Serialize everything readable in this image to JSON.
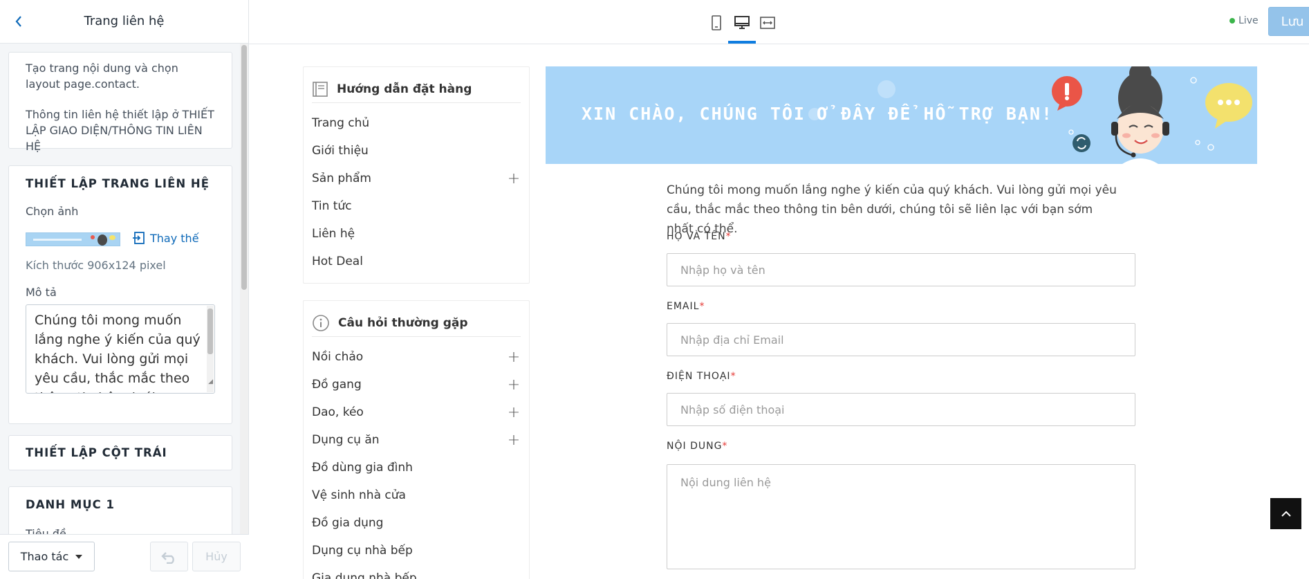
{
  "sidebar": {
    "title": "Trang liên hệ",
    "info_card": {
      "line1": "Tạo trang nội dung và chọn layout page.contact.",
      "line2": "Thông tin liên hệ thiết lập ở THIẾT LẬP GIAO DIỆN/THÔNG TIN LIÊN HỆ"
    },
    "contact_settings": {
      "title": "THIẾT LẬP TRANG LIÊN HỆ",
      "image_label": "Chọn ảnh",
      "replace_label": "Thay thế",
      "size_note": "Kích thước 906x124 pixel",
      "description_label": "Mô tả",
      "description_value": "Chúng tôi mong muốn lắng nghe ý kiến của quý khách. Vui lòng gửi mọi yêu cầu, thắc mắc theo thông tin bên dưới"
    },
    "left_column_title": "THIẾT LẬP CỘT TRÁI",
    "category1": {
      "title": "DANH MỤC 1",
      "subtitle": "Tiêu đề"
    },
    "footer": {
      "actions_label": "Thao tác",
      "cancel_label": "Hủy"
    }
  },
  "topbar": {
    "live_label": "Live",
    "save_label": "Lưu"
  },
  "preview": {
    "menu1": {
      "title": "Hướng dẫn đặt hàng",
      "items": [
        {
          "label": "Trang chủ",
          "expandable": false
        },
        {
          "label": "Giới thiệu",
          "expandable": false
        },
        {
          "label": "Sản phẩm",
          "expandable": true
        },
        {
          "label": "Tin tức",
          "expandable": false
        },
        {
          "label": "Liên hệ",
          "expandable": false
        },
        {
          "label": "Hot Deal",
          "expandable": false
        }
      ]
    },
    "menu2": {
      "title": "Câu hỏi thường gặp",
      "items": [
        {
          "label": "Nồi chảo",
          "expandable": true
        },
        {
          "label": "Đồ gang",
          "expandable": true
        },
        {
          "label": "Dao, kéo",
          "expandable": true
        },
        {
          "label": "Dụng cụ ăn",
          "expandable": true
        },
        {
          "label": "Đồ dùng gia đình",
          "expandable": false
        },
        {
          "label": "Vệ sinh nhà cửa",
          "expandable": false
        },
        {
          "label": "Đồ gia dụng",
          "expandable": false
        },
        {
          "label": "Dụng cụ nhà bếp",
          "expandable": false
        },
        {
          "label": "Gia dụng nhà bếp",
          "expandable": false
        }
      ]
    },
    "banner_text": "XIN CHÀO, CHÚNG TÔI Ở ĐÂY ĐỂ HỖ TRỢ BẠN!",
    "form": {
      "intro": "Chúng tôi mong muốn lắng nghe ý kiến của quý khách. Vui lòng gửi mọi yêu cầu, thắc mắc theo thông tin bên dưới, chúng tôi sẽ liên lạc với bạn sớm nhất có thể.",
      "name_label": "HỌ VÀ TÊN",
      "name_placeholder": "Nhập họ và tên",
      "email_label": "EMAIL",
      "email_placeholder": "Nhập địa chỉ Email",
      "phone_label": "ĐIỆN THOẠI",
      "phone_placeholder": "Nhập số điện thoại",
      "content_label": "NỘI DUNG",
      "content_placeholder": "Nội dung liên hệ",
      "required_mark": "*"
    }
  },
  "colors": {
    "accent": "#0f7de0",
    "banner_bg": "#a8d5f8",
    "save_bg": "#94c3ea",
    "live_dot": "#3bb54a",
    "required": "#e53935"
  }
}
